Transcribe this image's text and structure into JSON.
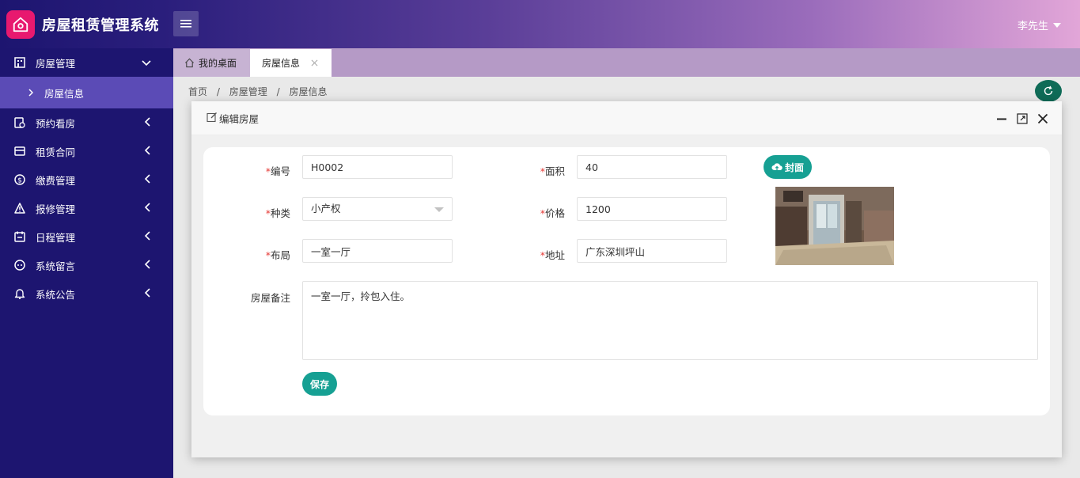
{
  "header": {
    "app_title": "房屋租赁管理系统",
    "user_name": "李先生"
  },
  "sidebar": {
    "items": [
      {
        "label": "房屋管理",
        "icon": "building-icon",
        "expanded": true
      },
      {
        "label": "房屋信息",
        "sub": true
      },
      {
        "label": "预约看房",
        "icon": "calendar-check-icon"
      },
      {
        "label": "租赁合同",
        "icon": "contract-icon"
      },
      {
        "label": "缴费管理",
        "icon": "dollar-icon"
      },
      {
        "label": "报修管理",
        "icon": "warning-icon"
      },
      {
        "label": "日程管理",
        "icon": "schedule-icon"
      },
      {
        "label": "系统留言",
        "icon": "message-icon"
      },
      {
        "label": "系统公告",
        "icon": "bell-icon"
      }
    ]
  },
  "tabs": [
    {
      "label": "我的桌面"
    },
    {
      "label": "房屋信息"
    }
  ],
  "breadcrumb": [
    "首页",
    "/",
    "房屋管理",
    "/",
    "房屋信息"
  ],
  "modal": {
    "title": "编辑房屋",
    "fields": {
      "code": {
        "label": "编号",
        "value": "H0002"
      },
      "area": {
        "label": "面积",
        "value": "40"
      },
      "type": {
        "label": "种类",
        "value": "小产权"
      },
      "price": {
        "label": "价格",
        "value": "1200"
      },
      "layout": {
        "label": "布局",
        "value": "一室一厅"
      },
      "address": {
        "label": "地址",
        "value": "广东深圳坪山"
      },
      "remark": {
        "label": "房屋备注",
        "value": "一室一厅，拎包入住。"
      }
    },
    "cover_button": "封面",
    "save_button": "保存"
  },
  "colors": {
    "accent": "#16a093",
    "sidebar": "#1d1570",
    "logo": "#e8196f"
  }
}
